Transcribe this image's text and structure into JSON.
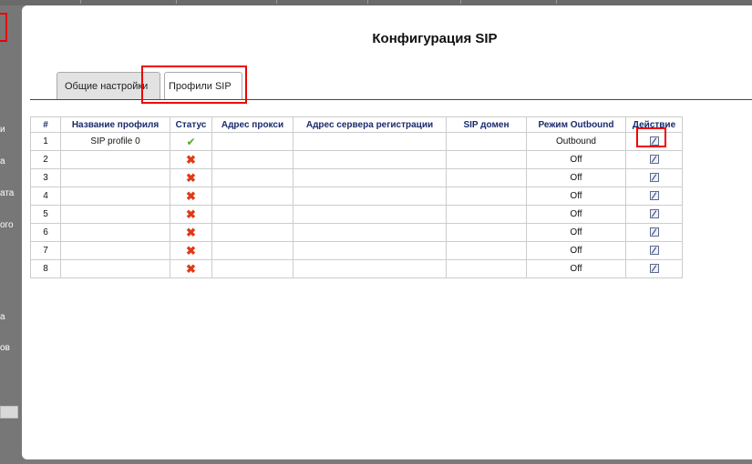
{
  "dialog": {
    "title": "Конфигурация SIP"
  },
  "tabs": [
    {
      "label": "Общие настройки",
      "active": false
    },
    {
      "label": "Профили SIP",
      "active": true
    }
  ],
  "background_sidebar_fragments": [
    "и",
    "а",
    "ата",
    "ого",
    "а",
    "ов"
  ],
  "table": {
    "columns": [
      "#",
      "Название профиля",
      "Статус",
      "Адрес прокси",
      "Адрес сервера регистрации",
      "SIP домен",
      "Режим Outbound",
      "Действие"
    ],
    "rows": [
      {
        "num": "1",
        "name": "SIP profile 0",
        "status": "enabled",
        "proxy": "",
        "registrar": "",
        "domain": "",
        "outbound": "Outbound"
      },
      {
        "num": "2",
        "name": "",
        "status": "disabled",
        "proxy": "",
        "registrar": "",
        "domain": "",
        "outbound": "Off"
      },
      {
        "num": "3",
        "name": "",
        "status": "disabled",
        "proxy": "",
        "registrar": "",
        "domain": "",
        "outbound": "Off"
      },
      {
        "num": "4",
        "name": "",
        "status": "disabled",
        "proxy": "",
        "registrar": "",
        "domain": "",
        "outbound": "Off"
      },
      {
        "num": "5",
        "name": "",
        "status": "disabled",
        "proxy": "",
        "registrar": "",
        "domain": "",
        "outbound": "Off"
      },
      {
        "num": "6",
        "name": "",
        "status": "disabled",
        "proxy": "",
        "registrar": "",
        "domain": "",
        "outbound": "Off"
      },
      {
        "num": "7",
        "name": "",
        "status": "disabled",
        "proxy": "",
        "registrar": "",
        "domain": "",
        "outbound": "Off"
      },
      {
        "num": "8",
        "name": "",
        "status": "disabled",
        "proxy": "",
        "registrar": "",
        "domain": "",
        "outbound": "Off"
      }
    ]
  },
  "icons": {
    "enabled": "check-icon",
    "disabled": "cross-icon",
    "action": "edit-icon"
  },
  "colors": {
    "header_text": "#1a2a6c",
    "highlight": "#e00000",
    "check": "#5aa52b",
    "cross": "#e23a16"
  }
}
